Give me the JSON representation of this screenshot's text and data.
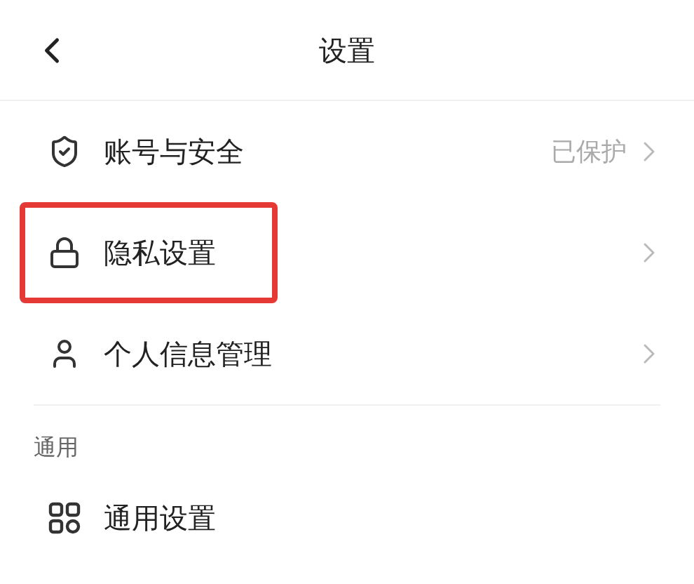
{
  "header": {
    "title": "设置"
  },
  "sections": [
    {
      "items": [
        {
          "label": "账号与安全",
          "value": "已保护",
          "highlighted": false
        },
        {
          "label": "隐私设置",
          "highlighted": true
        },
        {
          "label": "个人信息管理",
          "highlighted": false
        }
      ]
    },
    {
      "heading": "通用",
      "items": [
        {
          "label": "通用设置",
          "highlighted": false
        }
      ]
    }
  ]
}
